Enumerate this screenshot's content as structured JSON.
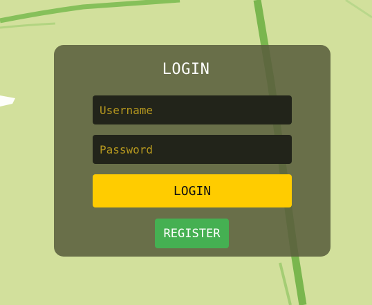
{
  "login_form": {
    "title": "LOGIN",
    "username_placeholder": "Username",
    "password_placeholder": "Password",
    "login_label": "LOGIN",
    "register_label": "REGISTER"
  },
  "colors": {
    "map_background": "#d2e09c",
    "panel": "#5a5f3e",
    "login_button": "#ffcc00",
    "register_button": "#45b052",
    "placeholder_text": "#b6981f"
  }
}
